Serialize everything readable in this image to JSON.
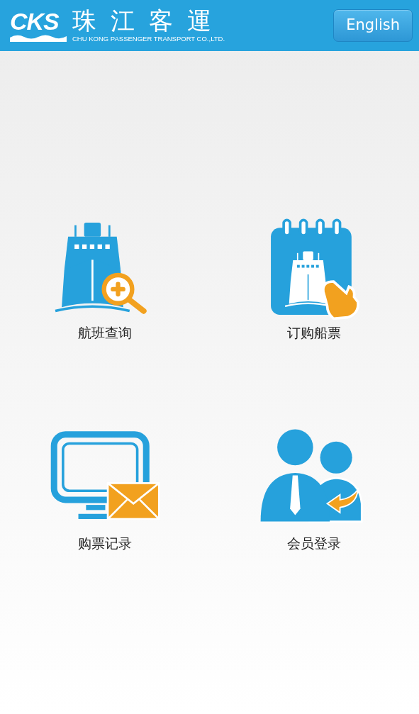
{
  "header": {
    "logo_mark": "CKS",
    "logo_title": "珠江客運",
    "logo_subtitle": "CHU KONG PASSENGER TRANSPORT CO.,LTD.",
    "language_button": "English"
  },
  "menu": [
    {
      "kind": "schedule",
      "label": "航班查询"
    },
    {
      "kind": "booking",
      "label": "订购船票"
    },
    {
      "kind": "records",
      "label": "购票记录"
    },
    {
      "kind": "member",
      "label": "会员登录"
    }
  ]
}
